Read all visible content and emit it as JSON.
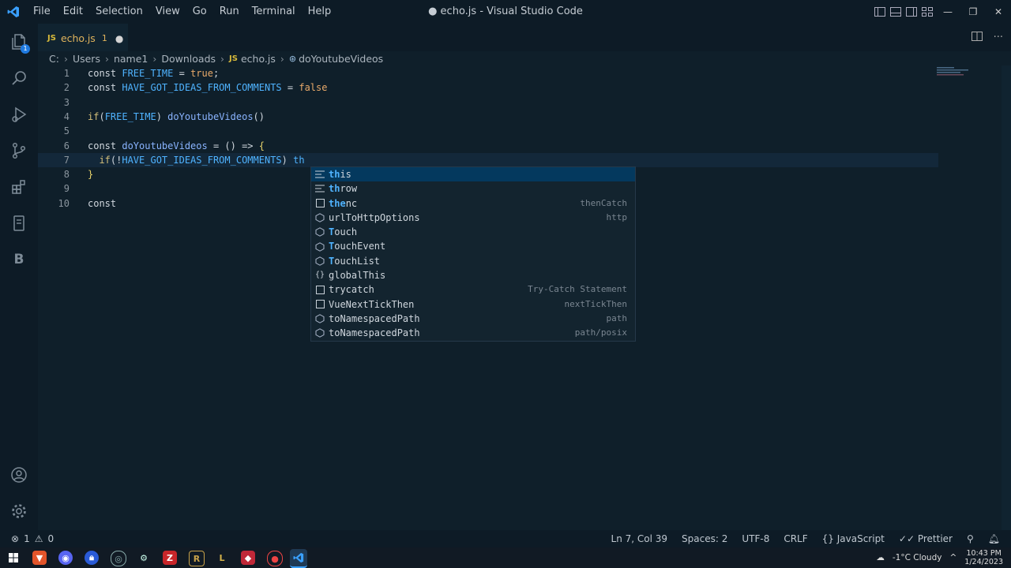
{
  "titlebar": {
    "menu": [
      "File",
      "Edit",
      "Selection",
      "View",
      "Go",
      "Run",
      "Terminal",
      "Help"
    ],
    "title": "● echo.js - Visual Studio Code"
  },
  "activity": {
    "source_control_badge": "1",
    "b_label": "B"
  },
  "tab": {
    "icon_text": "JS",
    "filename": "echo.js",
    "problem_count": "1",
    "dirty": "●"
  },
  "breadcrumb": {
    "parts": [
      "C:",
      "Users",
      "name1",
      "Downloads",
      "echo.js",
      "doYoutubeVideos"
    ],
    "js_icon": "JS"
  },
  "editor": {
    "line_numbers": [
      "1",
      "2",
      "3",
      "4",
      "5",
      "6",
      "7",
      "8",
      "9",
      "10"
    ],
    "lines": [
      [
        [
          "kw",
          "const "
        ],
        [
          "var",
          "FREE_TIME"
        ],
        [
          "op",
          " = "
        ],
        [
          "bool",
          "true"
        ],
        [
          "op",
          ";"
        ]
      ],
      [
        [
          "kw",
          "const "
        ],
        [
          "var",
          "HAVE_GOT_IDEAS_FROM_COMMENTS"
        ],
        [
          "op",
          " = "
        ],
        [
          "bool",
          "false"
        ]
      ],
      [],
      [
        [
          "cond",
          "if"
        ],
        [
          "paren",
          "("
        ],
        [
          "var",
          "FREE_TIME"
        ],
        [
          "paren",
          ") "
        ],
        [
          "fn",
          "doYoutubeVideos"
        ],
        [
          "paren",
          "()"
        ]
      ],
      [],
      [
        [
          "kw",
          "const "
        ],
        [
          "fn",
          "doYoutubeVideos"
        ],
        [
          "op",
          " = () => "
        ],
        [
          "brace",
          "{"
        ]
      ],
      [
        [
          "op",
          "  "
        ],
        [
          "cond",
          "if"
        ],
        [
          "paren",
          "(!"
        ],
        [
          "var",
          "HAVE_GOT_IDEAS_FROM_COMMENTS"
        ],
        [
          "paren",
          ") "
        ],
        [
          "var",
          "th"
        ]
      ],
      [
        [
          "brace",
          "}"
        ]
      ],
      [],
      [
        [
          "kw",
          "const"
        ]
      ]
    ]
  },
  "suggestions": [
    {
      "icon": "kw",
      "match": "th",
      "rest": "is",
      "detail": ""
    },
    {
      "icon": "kw",
      "match": "th",
      "rest": "row",
      "detail": ""
    },
    {
      "icon": "snip",
      "match": "the",
      "rest": "nc",
      "detail": "thenCatch"
    },
    {
      "icon": "var",
      "match": "",
      "rest": "urlToHttpOptions",
      "detail": "http"
    },
    {
      "icon": "var",
      "match": "T",
      "rest": "ouch",
      "detail": ""
    },
    {
      "icon": "var",
      "match": "T",
      "rest": "ouchEvent",
      "detail": ""
    },
    {
      "icon": "var",
      "match": "T",
      "rest": "ouchList",
      "detail": ""
    },
    {
      "icon": "mod",
      "match": "",
      "rest": "globalThis",
      "detail": ""
    },
    {
      "icon": "snip",
      "match": "",
      "rest": "trycatch",
      "detail": "Try-Catch Statement"
    },
    {
      "icon": "snip",
      "match": "",
      "rest": "VueNextTickThen",
      "detail": "nextTickThen"
    },
    {
      "icon": "var",
      "match": "",
      "rest": "toNamespacedPath",
      "detail": "path"
    },
    {
      "icon": "var",
      "match": "",
      "rest": "toNamespacedPath",
      "detail": "path/posix"
    }
  ],
  "statusbar": {
    "errors": "1",
    "warnings": "0",
    "position": "Ln 7, Col 39",
    "spaces": "Spaces: 2",
    "encoding": "UTF-8",
    "eol": "CRLF",
    "language": "JavaScript",
    "formatter": "Prettier"
  },
  "taskbar": {
    "weather": "-1°C Cloudy",
    "time": "10:43 PM",
    "date": "1/24/2023"
  },
  "colors": {
    "accent": "#1f7ae0",
    "background": "#0f1f2a",
    "selection": "#04395e"
  }
}
